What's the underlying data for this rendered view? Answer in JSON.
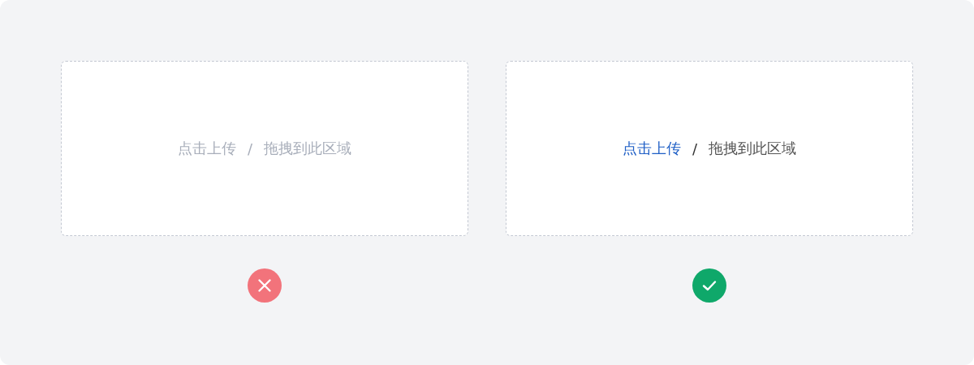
{
  "examples": [
    {
      "kind": "wrong",
      "link": "点击上传",
      "link_highlighted": false,
      "separator": "/",
      "text": "拖拽到此区域"
    },
    {
      "kind": "right",
      "link": "点击上传",
      "link_highlighted": true,
      "separator": "/",
      "text": "拖拽到此区域"
    }
  ]
}
